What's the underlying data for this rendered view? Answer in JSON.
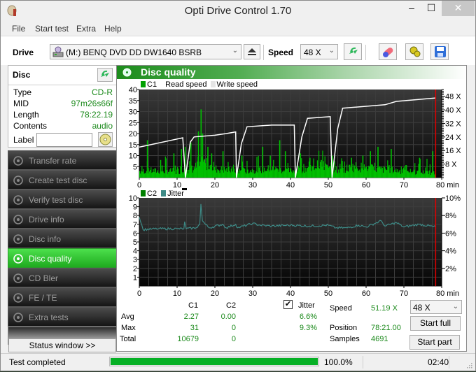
{
  "window": {
    "title": "Opti Drive Control 1.70",
    "minimize_glyph": "–",
    "maximize_glyph": "☐",
    "close_glyph": "✕"
  },
  "menu": [
    "File",
    "Start test",
    "Extra",
    "Help"
  ],
  "toolbar": {
    "drive_label": "Drive",
    "drive_value": "(M:)   BENQ DVD DD DW1640 BSRB",
    "speed_label": "Speed",
    "speed_value": "48 X",
    "icons": [
      "drive-icon",
      "eject-icon",
      "refresh-icon",
      "erase-icon",
      "settings-icon",
      "save-icon"
    ]
  },
  "disc": {
    "title": "Disc",
    "rows": [
      {
        "key": "Type",
        "value": "CD-R"
      },
      {
        "key": "MID",
        "value": "97m26s66f"
      },
      {
        "key": "Length",
        "value": "78:22.19"
      },
      {
        "key": "Contents",
        "value": "audio"
      }
    ],
    "label_key": "Label",
    "label_value": ""
  },
  "nav": [
    {
      "label": "Transfer rate",
      "active": false
    },
    {
      "label": "Create test disc",
      "active": false
    },
    {
      "label": "Verify test disc",
      "active": false
    },
    {
      "label": "Drive info",
      "active": false
    },
    {
      "label": "Disc info",
      "active": false
    },
    {
      "label": "Disc quality",
      "active": true
    },
    {
      "label": "CD Bler",
      "active": false
    },
    {
      "label": "FE / TE",
      "active": false
    },
    {
      "label": "Extra tests",
      "active": false
    }
  ],
  "status_window_label": "Status window >>",
  "panel": {
    "title": "Disc quality"
  },
  "colors": {
    "c1": "#00c000",
    "c2": "#008000",
    "jitter": "#3d8a86",
    "read_speed": "#ffffff",
    "write_speed": "#e8e8e8",
    "end_marker": "#e00000",
    "accent_green": "#1c8a1c"
  },
  "chart_data": [
    {
      "type": "bar",
      "title": "C1 / Read speed",
      "legend": [
        "C1",
        "Read speed",
        "Write speed"
      ],
      "xlabel": "min",
      "x_ticks": [
        0,
        10,
        20,
        30,
        40,
        50,
        60,
        70,
        80
      ],
      "x_tick_labels": [
        "0",
        "10",
        "20",
        "30",
        "40",
        "50",
        "60",
        "70",
        "80 min"
      ],
      "xlim": [
        0,
        80
      ],
      "ylim": [
        0,
        40
      ],
      "y_ticks": [
        5,
        10,
        15,
        20,
        25,
        30,
        35,
        40
      ],
      "y2lim": [
        0,
        52
      ],
      "y2_ticks": [
        8,
        16,
        24,
        32,
        40,
        48
      ],
      "y2_tick_labels": [
        "8 X",
        "16 X",
        "24 X",
        "32 X",
        "40 X",
        "48 X"
      ],
      "grid": true,
      "end_marker_min": 78.4,
      "c1_spikes": [
        {
          "x": 2,
          "y": 17
        },
        {
          "x": 5.5,
          "y": 8
        },
        {
          "x": 9,
          "y": 11
        },
        {
          "x": 11,
          "y": 13
        },
        {
          "x": 12,
          "y": 14
        },
        {
          "x": 13.5,
          "y": 16
        },
        {
          "x": 15.5,
          "y": 21
        },
        {
          "x": 16.2,
          "y": 31
        },
        {
          "x": 16.6,
          "y": 20
        },
        {
          "x": 18,
          "y": 14
        },
        {
          "x": 19,
          "y": 11
        },
        {
          "x": 22,
          "y": 12
        },
        {
          "x": 27,
          "y": 10
        },
        {
          "x": 32.5,
          "y": 14
        },
        {
          "x": 34.5,
          "y": 10
        },
        {
          "x": 37,
          "y": 17
        },
        {
          "x": 38.5,
          "y": 12
        },
        {
          "x": 42.5,
          "y": 11
        },
        {
          "x": 45,
          "y": 9
        },
        {
          "x": 48,
          "y": 8
        },
        {
          "x": 51,
          "y": 10
        },
        {
          "x": 56,
          "y": 9
        },
        {
          "x": 59,
          "y": 10
        },
        {
          "x": 61,
          "y": 12
        },
        {
          "x": 63,
          "y": 14
        },
        {
          "x": 66.5,
          "y": 13
        },
        {
          "x": 74,
          "y": 9
        },
        {
          "x": 77.5,
          "y": 12
        }
      ],
      "c1_baseline": [
        {
          "x": 0,
          "y": 3
        },
        {
          "x": 10,
          "y": 3
        },
        {
          "x": 14,
          "y": 4
        },
        {
          "x": 17,
          "y": 7
        },
        {
          "x": 20,
          "y": 4
        },
        {
          "x": 26,
          "y": 3
        },
        {
          "x": 35,
          "y": 4
        },
        {
          "x": 40,
          "y": 3
        },
        {
          "x": 46,
          "y": 5
        },
        {
          "x": 50,
          "y": 7
        },
        {
          "x": 52,
          "y": 3
        },
        {
          "x": 57,
          "y": 5
        },
        {
          "x": 62,
          "y": 4
        },
        {
          "x": 70,
          "y": 3
        },
        {
          "x": 78,
          "y": 2
        }
      ],
      "read_speed_segments": [
        [
          [
            0,
            18
          ],
          [
            11.5,
            23.5
          ],
          [
            12.2,
            0
          ],
          [
            13.5,
            21
          ],
          [
            14.5,
            24
          ],
          [
            20,
            25
          ],
          [
            23,
            26
          ],
          [
            25.5,
            27
          ],
          [
            25.7,
            0
          ],
          [
            27,
            20
          ],
          [
            28.5,
            30
          ],
          [
            35,
            31
          ],
          [
            41,
            31
          ],
          [
            41.3,
            0
          ],
          [
            43,
            24
          ],
          [
            44.5,
            35
          ],
          [
            50.5,
            36
          ],
          [
            51,
            0
          ],
          [
            52.5,
            29
          ],
          [
            53.8,
            41
          ],
          [
            65,
            43
          ],
          [
            68,
            45
          ],
          [
            78.4,
            47
          ]
        ]
      ],
      "read_speed_units": "X"
    },
    {
      "type": "line",
      "title": "C2 / Jitter",
      "legend": [
        "C2",
        "Jitter"
      ],
      "xlabel": "min",
      "x_ticks": [
        0,
        10,
        20,
        30,
        40,
        50,
        60,
        70,
        80
      ],
      "x_tick_labels": [
        "0",
        "10",
        "20",
        "30",
        "40",
        "50",
        "60",
        "70",
        "80 min"
      ],
      "xlim": [
        0,
        80
      ],
      "ylim": [
        0,
        10
      ],
      "y_ticks": [
        1,
        2,
        3,
        4,
        5,
        6,
        7,
        8,
        9,
        10
      ],
      "y2lim": [
        0,
        10
      ],
      "y2_ticks": [
        2,
        4,
        6,
        8,
        10
      ],
      "y2_tick_labels": [
        "2%",
        "4%",
        "6%",
        "8%",
        "10%"
      ],
      "grid": true,
      "end_marker_min": 78.4,
      "c2_values": "all zero",
      "jitter_percent": [
        [
          0,
          7.8
        ],
        [
          1,
          6.4
        ],
        [
          5,
          6.5
        ],
        [
          10,
          6.5
        ],
        [
          11.8,
          6.5
        ],
        [
          12,
          7.3
        ],
        [
          12.4,
          6.5
        ],
        [
          15,
          6.6
        ],
        [
          16,
          7.0
        ],
        [
          16.3,
          9.3
        ],
        [
          16.7,
          7.4
        ],
        [
          17.5,
          7.0
        ],
        [
          18.5,
          6.6
        ],
        [
          22,
          7.0
        ],
        [
          23,
          6.6
        ],
        [
          25.5,
          7.0
        ],
        [
          26,
          6.6
        ],
        [
          30,
          7.1
        ],
        [
          32,
          6.9
        ],
        [
          35,
          6.8
        ],
        [
          40,
          6.9
        ],
        [
          45,
          6.8
        ],
        [
          50,
          6.9
        ],
        [
          52,
          6.6
        ],
        [
          55,
          6.6
        ],
        [
          58,
          6.9
        ],
        [
          60,
          6.7
        ],
        [
          64,
          7.4
        ],
        [
          65,
          6.8
        ],
        [
          68,
          7.2
        ],
        [
          70,
          6.7
        ],
        [
          74,
          7.0
        ],
        [
          78.4,
          6.7
        ]
      ]
    }
  ],
  "stats": {
    "col_c1": "C1",
    "col_c2": "C2",
    "jitter_label": "Jitter",
    "jitter_checked": true,
    "rows": [
      {
        "label": "Avg",
        "c1": "2.27",
        "c2": "0.00",
        "jitter": "6.6%"
      },
      {
        "label": "Max",
        "c1": "31",
        "c2": "0",
        "jitter": "9.3%"
      },
      {
        "label": "Total",
        "c1": "10679",
        "c2": "0",
        "jitter": ""
      }
    ],
    "speed_label": "Speed",
    "speed_value": "51.19 X",
    "position_label": "Position",
    "position_value": "78:21.00",
    "samples_label": "Samples",
    "samples_value": "4691",
    "speed_select": "48 X",
    "start_full": "Start full",
    "start_part": "Start part"
  },
  "statusbar": {
    "text": "Test completed",
    "progress": 1.0,
    "progress_text": "100.0%",
    "time": "02:40"
  }
}
